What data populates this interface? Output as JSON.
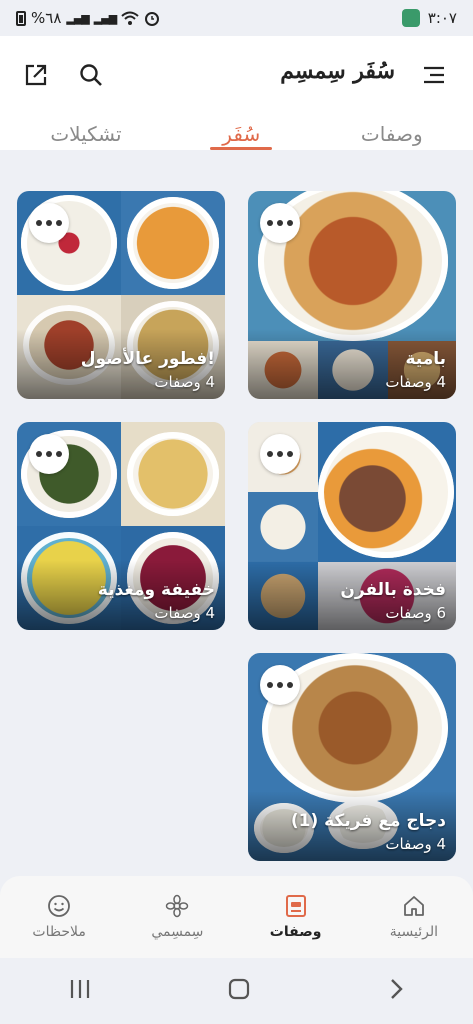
{
  "status_bar": {
    "battery": "%٦٨",
    "time": "٣:٠٧"
  },
  "header": {
    "title": "سُفَر سِمسِم"
  },
  "tabs": [
    {
      "label": "وصفات",
      "active": false
    },
    {
      "label": "سُفَر",
      "active": true
    },
    {
      "label": "تشكيلات",
      "active": false
    }
  ],
  "cards": [
    {
      "name": "بامية",
      "count": "4 وصفات"
    },
    {
      "name": "فطور عالأصول!",
      "count": "4 وصفات"
    },
    {
      "name": "فخدة بالفرن",
      "count": "6 وصفات"
    },
    {
      "name": "خفيفة ومغذية",
      "count": "4 وصفات"
    },
    {
      "name": "دجاج مع فريكة (1)",
      "count": "4 وصفات"
    }
  ],
  "bottom_nav": [
    {
      "label": "الرئيسية",
      "icon": "home-icon",
      "active": false
    },
    {
      "label": "وصفات",
      "icon": "recipe-book-icon",
      "active": true
    },
    {
      "label": "سِمسِمي",
      "icon": "flower-icon",
      "active": false
    },
    {
      "label": "ملاحظات",
      "icon": "smiley-icon",
      "active": false
    }
  ],
  "colors": {
    "accent": "#e06a4a",
    "background": "#eef0f5"
  }
}
